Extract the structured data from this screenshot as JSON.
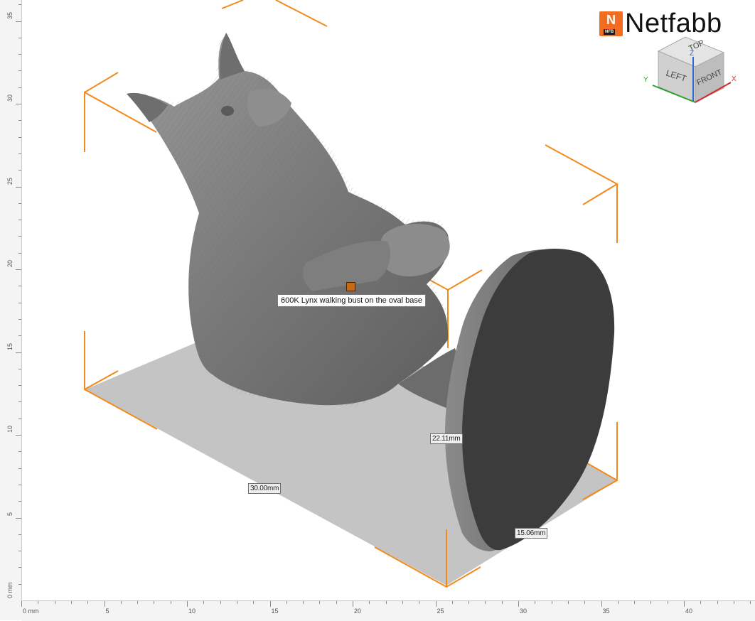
{
  "app": {
    "brand_badge": "N",
    "brand_badge_sub": "NFB",
    "brand_name": "Netfabb"
  },
  "viewcube": {
    "faces": {
      "top": "TOP",
      "left": "LEFT",
      "front": "FRONT"
    },
    "axes": {
      "x": "X",
      "y": "Y",
      "z": "Z"
    },
    "axis_colors": {
      "x": "#d62828",
      "y": "#2ca02c",
      "z": "#2b6cd6"
    }
  },
  "part": {
    "tooltip": "600K Lynx walking bust on the oval base",
    "marker_color": "#c86a12"
  },
  "dimensions": {
    "length": "30.00mm",
    "height": "22.11mm",
    "width": "15.06mm"
  },
  "colors": {
    "bounding_box": "#f28a1c",
    "build_plate": "#c4c4c4",
    "model": "#7d7d7d",
    "cut_face": "#3c3c3c"
  },
  "rulers": {
    "horizontal": {
      "start_label": "0 mm",
      "labels": [
        "5",
        "10",
        "15",
        "20",
        "25",
        "30",
        "35",
        "40"
      ]
    },
    "vertical": {
      "start_label": "0 mm",
      "labels": [
        "5",
        "10",
        "15",
        "20",
        "25",
        "30",
        "35"
      ]
    }
  }
}
